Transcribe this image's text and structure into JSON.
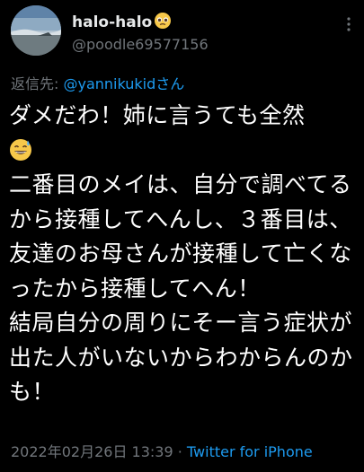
{
  "author": {
    "display_name": "halo-halo",
    "display_emoji": "pleading-face-icon",
    "handle": "@poodle69577156"
  },
  "reply": {
    "prefix": "返信先: ",
    "mention": "@yannikukid",
    "suffix": "さん"
  },
  "tweet": {
    "line1": "ダメだわ！姉に言うても全然",
    "emoji_after_line1": "grinning-sweat-icon",
    "body": "二番目のメイは、自分で調べてるから接種してへんし、３番目は、友達のお母さんが接種して亡くなったから接種してへん！\n結局自分の周りにそー言う症状が出た人がいないからわからんのかも！"
  },
  "meta": {
    "timestamp": "2022年02月26日 13:39",
    "separator": " · ",
    "source": "Twitter for iPhone"
  },
  "colors": {
    "background": "#000000",
    "text": "#ffffff",
    "secondary": "#71767b",
    "link": "#1d9bf0"
  }
}
